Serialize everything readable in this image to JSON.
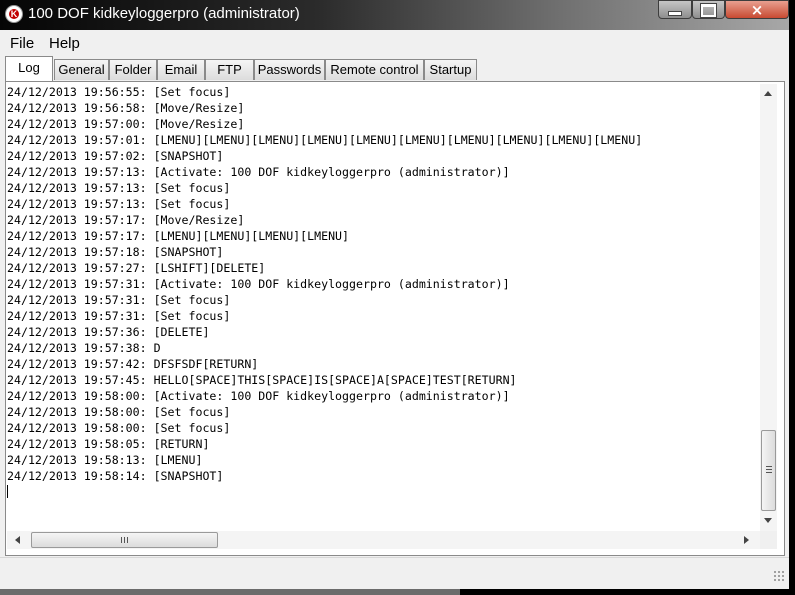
{
  "window": {
    "title": "100 DOF kidkeyloggerpro (administrator)",
    "app_icon_letter": "K",
    "controls": {
      "minimize": "minimize",
      "maximize": "maximize",
      "close": "×"
    }
  },
  "menu": [
    "File",
    "Help"
  ],
  "tabs": [
    {
      "label": "Log",
      "active": true
    },
    {
      "label": "General",
      "active": false
    },
    {
      "label": "Folder",
      "active": false
    },
    {
      "label": "Email",
      "active": false
    },
    {
      "label": "FTP",
      "active": false
    },
    {
      "label": "Passwords",
      "active": false
    },
    {
      "label": "Remote control",
      "active": false
    },
    {
      "label": "Startup",
      "active": false
    }
  ],
  "log": [
    "24/12/2013 19:56:55: [Set focus]",
    "24/12/2013 19:56:58: [Move/Resize]",
    "24/12/2013 19:57:00: [Move/Resize]",
    "24/12/2013 19:57:01: [LMENU][LMENU][LMENU][LMENU][LMENU][LMENU][LMENU][LMENU][LMENU][LMENU]",
    "24/12/2013 19:57:02: [SNAPSHOT]",
    "24/12/2013 19:57:13: [Activate: 100 DOF kidkeyloggerpro (administrator)]",
    "24/12/2013 19:57:13: [Set focus]",
    "24/12/2013 19:57:13: [Set focus]",
    "24/12/2013 19:57:17: [Move/Resize]",
    "24/12/2013 19:57:17: [LMENU][LMENU][LMENU][LMENU]",
    "24/12/2013 19:57:18: [SNAPSHOT]",
    "24/12/2013 19:57:27: [LSHIFT][DELETE]",
    "24/12/2013 19:57:31: [Activate: 100 DOF kidkeyloggerpro (administrator)]",
    "24/12/2013 19:57:31: [Set focus]",
    "24/12/2013 19:57:31: [Set focus]",
    "24/12/2013 19:57:36: [DELETE]",
    "24/12/2013 19:57:38: D",
    "24/12/2013 19:57:42: DFSFSDF[RETURN]",
    "24/12/2013 19:57:45: HELLO[SPACE]THIS[SPACE]IS[SPACE]A[SPACE]TEST[RETURN]",
    "24/12/2013 19:58:00: [Activate: 100 DOF kidkeyloggerpro (administrator)]",
    "24/12/2013 19:58:00: [Set focus]",
    "24/12/2013 19:58:00: [Set focus]",
    "24/12/2013 19:58:05: [RETURN]",
    "24/12/2013 19:58:13: [LMENU]",
    "24/12/2013 19:58:14: [SNAPSHOT]"
  ],
  "scroll": {
    "vertical_position": 1.0,
    "horizontal_position": 0.0
  },
  "icons": {
    "scroll_up": "scroll-up-arrow-icon",
    "scroll_down": "scroll-down-arrow-icon",
    "scroll_left": "scroll-left-arrow-icon",
    "scroll_right": "scroll-right-arrow-icon",
    "size_grip": "size-grip-icon"
  },
  "colors": {
    "close_button": "#c84a32",
    "titlebar": "#050505"
  }
}
